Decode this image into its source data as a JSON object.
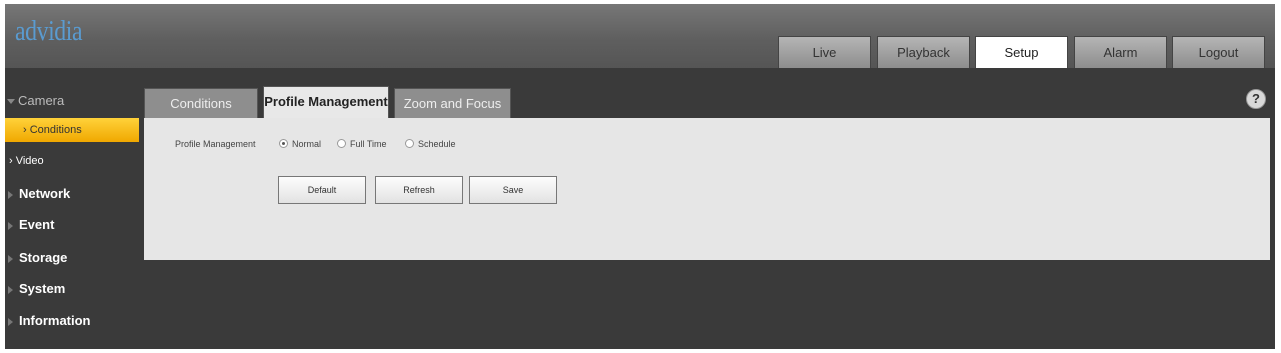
{
  "header": {
    "logo": "advidia"
  },
  "nav": {
    "tabs": [
      "Live",
      "Playback",
      "Setup",
      "Alarm",
      "Logout"
    ],
    "active": "Setup"
  },
  "sidebar": {
    "camera": "Camera",
    "conditions": "› Conditions",
    "video": "› Video",
    "items": [
      "Network",
      "Event",
      "Storage",
      "System",
      "Information"
    ]
  },
  "content": {
    "tabs": [
      "Conditions",
      "Profile Management",
      "Zoom and Focus"
    ],
    "active_tab": "Profile Management",
    "help": "?"
  },
  "form": {
    "label": "Profile Management",
    "options": [
      "Normal",
      "Full Time",
      "Schedule"
    ],
    "selected": "Normal"
  },
  "buttons": {
    "default": "Default",
    "refresh": "Refresh",
    "save": "Save"
  }
}
